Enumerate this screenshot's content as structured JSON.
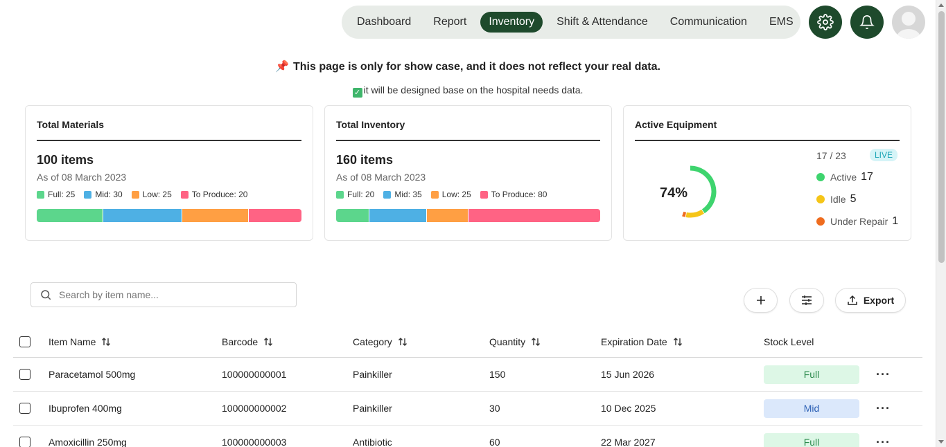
{
  "nav": {
    "items": [
      {
        "label": "Dashboard",
        "active": false
      },
      {
        "label": "Report",
        "active": false
      },
      {
        "label": "Inventory",
        "active": true
      },
      {
        "label": "Shift & Attendance",
        "active": false
      },
      {
        "label": "Communication",
        "active": false
      },
      {
        "label": "EMS",
        "active": false
      }
    ],
    "settings_icon": "gear-icon",
    "notifications_icon": "bell-icon",
    "avatar_icon": "user-avatar"
  },
  "notice": {
    "title": "This page is only for show case, and it does not reflect your real data.",
    "subtitle": "it will be designed base on the hospital needs data."
  },
  "cards": {
    "materials": {
      "title": "Total Materials",
      "total": "100 items",
      "as_of": "As of 08 March 2023",
      "legend": [
        {
          "label": "Full: 25",
          "value": 25,
          "color": "#5cd68c"
        },
        {
          "label": "Mid: 30",
          "value": 30,
          "color": "#4eb0e4"
        },
        {
          "label": "Low: 25",
          "value": 25,
          "color": "#ff9f43"
        },
        {
          "label": "To Produce: 20",
          "value": 20,
          "color": "#ff6384"
        }
      ]
    },
    "inventory": {
      "title": "Total Inventory",
      "total": "160 items",
      "as_of": "As of 08 March 2023",
      "legend": [
        {
          "label": "Full: 20",
          "value": 20,
          "color": "#5cd68c"
        },
        {
          "label": "Mid: 35",
          "value": 35,
          "color": "#4eb0e4"
        },
        {
          "label": "Low: 25",
          "value": 25,
          "color": "#ff9f43"
        },
        {
          "label": "To Produce: 80",
          "value": 80,
          "color": "#ff6384"
        }
      ]
    },
    "equipment": {
      "title": "Active Equipment",
      "percent_label": "74%",
      "count_label": "17 / 23",
      "live_label": "LIVE",
      "statuses": [
        {
          "label": "Active",
          "value": "17",
          "count": 17,
          "color": "#3ed46e"
        },
        {
          "label": "Idle",
          "value": "5",
          "count": 5,
          "color": "#f5c518"
        },
        {
          "label": "Under Repair",
          "value": "1",
          "count": 1,
          "color": "#ef6c1e"
        }
      ]
    }
  },
  "toolbar": {
    "search_placeholder": "Search by item name...",
    "add_icon": "plus-icon",
    "filter_icon": "sliders-icon",
    "export_label": "Export"
  },
  "table": {
    "columns": [
      "Item Name",
      "Barcode",
      "Category",
      "Quantity",
      "Expiration Date",
      "Stock Level"
    ],
    "rows": [
      {
        "name": "Paracetamol 500mg",
        "barcode": "100000000001",
        "category": "Painkiller",
        "quantity": "150",
        "expiry": "15 Jun 2026",
        "stock": "Full",
        "stock_bg": "#ddf7e6",
        "stock_fg": "#2c8a4d"
      },
      {
        "name": "Ibuprofen 400mg",
        "barcode": "100000000002",
        "category": "Painkiller",
        "quantity": "30",
        "expiry": "10 Dec 2025",
        "stock": "Mid",
        "stock_bg": "#dbe8fb",
        "stock_fg": "#2b5fb4"
      },
      {
        "name": "Amoxicillin 250mg",
        "barcode": "100000000003",
        "category": "Antibiotic",
        "quantity": "60",
        "expiry": "22 Mar 2027",
        "stock": "Full",
        "stock_bg": "#ddf7e6",
        "stock_fg": "#2c8a4d"
      }
    ]
  }
}
